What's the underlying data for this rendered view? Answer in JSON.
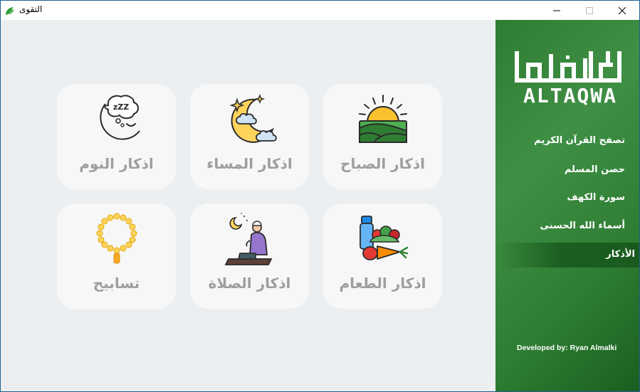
{
  "window": {
    "title": "التقوى",
    "app_icon": "green-leaves-icon",
    "controls": [
      "minimize-icon",
      "maximize-icon",
      "close-icon"
    ]
  },
  "sidebar": {
    "logo_text": "ALTAQWA",
    "logo_icon": "altaqwa-logo",
    "items": [
      {
        "label": "تصفح القرآن الكريم",
        "active": false
      },
      {
        "label": "حصن المسلم",
        "active": false
      },
      {
        "label": "سورة الكهف",
        "active": false
      },
      {
        "label": "أسماء الله الحسنى",
        "active": false
      },
      {
        "label": "الأذكار",
        "active": true
      }
    ],
    "credit": "Developed by: Ryan Almalki"
  },
  "cards": [
    {
      "label": "اذكار الصباح",
      "icon": "sunrise-fields-icon"
    },
    {
      "label": "اذكار المساء",
      "icon": "crescent-moon-stars-icon"
    },
    {
      "label": "اذكار النوم",
      "icon": "sleeping-moon-icon"
    },
    {
      "label": "اذكار الطعام",
      "icon": "food-vegetables-icon"
    },
    {
      "label": "اذكار الصلاة",
      "icon": "praying-man-icon"
    },
    {
      "label": "تسابيح",
      "icon": "prayer-beads-icon"
    }
  ],
  "colors": {
    "sidebar_green": "#2e7d32",
    "active_green": "#1b5e20",
    "card_bg": "#f7f7f7",
    "card_text": "#9e9e9e",
    "content_bg": "#eceff1"
  }
}
